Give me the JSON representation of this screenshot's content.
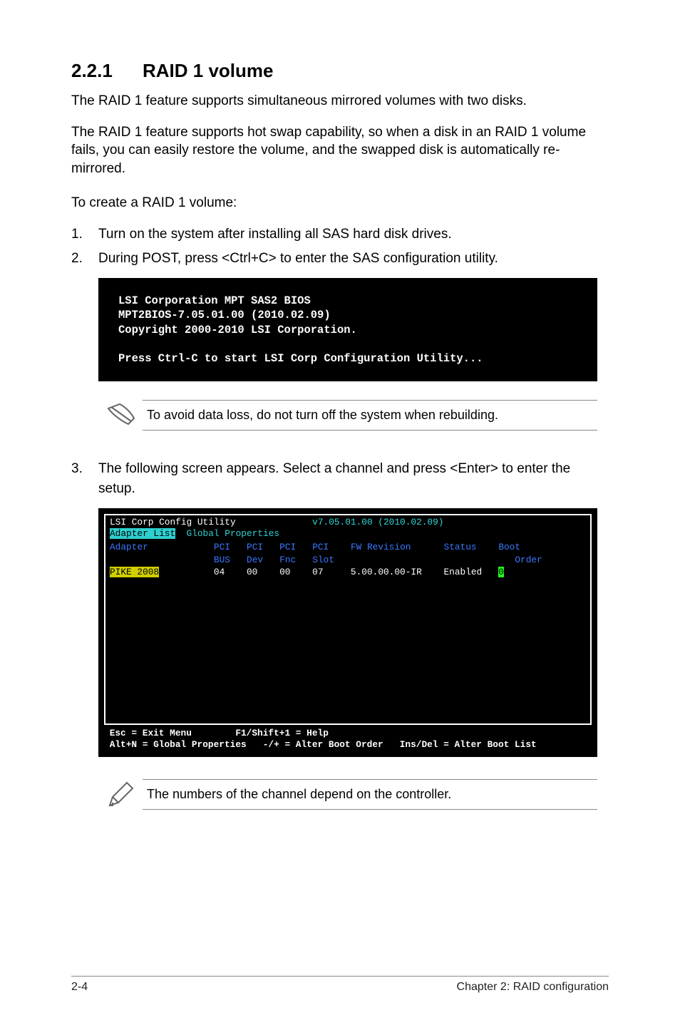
{
  "heading": {
    "number": "2.2.1",
    "title": "RAID 1 volume"
  },
  "para1": "The RAID 1 feature supports simultaneous mirrored volumes with two disks.",
  "para2": "The RAID 1 feature supports hot swap capability, so when a disk in an RAID 1 volume fails, you can easily restore the volume, and the swapped disk is automatically re-mirrored.",
  "para3": "To create a RAID 1 volume:",
  "steps": {
    "s1": {
      "n": "1.",
      "t": "Turn on the system after installing all SAS hard disk drives."
    },
    "s2": {
      "n": "2.",
      "t": "During POST, press <Ctrl+C> to enter the SAS configuration utility."
    },
    "s3": {
      "n": "3.",
      "t": "The following screen appears. Select a channel and press <Enter> to enter the setup."
    }
  },
  "term1": {
    "l1": "LSI Corporation MPT SAS2 BIOS",
    "l2": "MPT2BIOS-7.05.01.00 (2010.02.09)",
    "l3": "Copyright 2000-2010 LSI Corporation.",
    "l4": "",
    "l5": "Press Ctrl-C to start LSI Corp Configuration Utility..."
  },
  "note1": "To avoid data loss, do not turn off the system when rebuilding.",
  "note2": "The numbers of the channel depend on the controller.",
  "bios": {
    "titleL": "LSI Corp Config Utility",
    "titleR": "v7.05.01.00 (2010.02.09)",
    "tabA": "Adapter List",
    "tabB": "Global Properties",
    "cols": {
      "c1": "Adapter",
      "c2": "PCI",
      "c2b": "BUS",
      "c3": "PCI",
      "c3b": "Dev",
      "c4": "PCI",
      "c4b": "Fnc",
      "c5": "PCI",
      "c5b": "Slot",
      "c6": "FW Revision",
      "c7": "Status",
      "c8": "Boot",
      "c8b": "Order"
    },
    "row": {
      "adapter": "PIKE 2008",
      "bus": "04",
      "dev": "00",
      "fnc": "00",
      "slot": "07",
      "fw": "5.00.00.00-IR",
      "status": "Enabled",
      "boot": "0"
    },
    "footer": {
      "f1a": "Esc = Exit Menu",
      "f1b": "F1/Shift+1 = Help",
      "f2a": "Alt+N = Global Properties",
      "f2b": "-/+ = Alter Boot Order",
      "f2c": "Ins/Del = Alter Boot List"
    }
  },
  "footer": {
    "left": "2-4",
    "right": "Chapter 2: RAID configuration"
  }
}
